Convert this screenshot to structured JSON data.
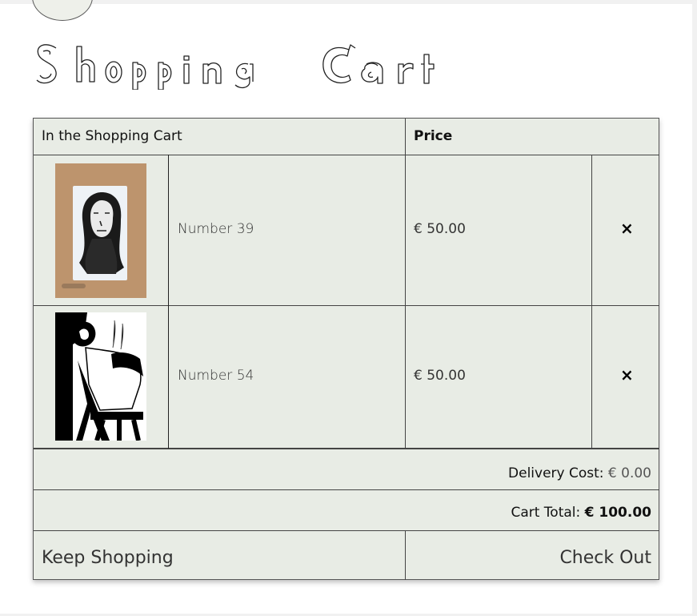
{
  "title": "Shopping Cart",
  "table": {
    "header_item": "In the Shopping Cart",
    "header_price": "Price"
  },
  "items": [
    {
      "name": "Number 39",
      "price": "€ 50.00",
      "remove_icon": "×"
    },
    {
      "name": "Number 54",
      "price": "€ 50.00",
      "remove_icon": "×"
    }
  ],
  "summary": {
    "delivery_label": "Delivery Cost:",
    "delivery_value": "€ 0.00",
    "total_label": "Cart Total:",
    "total_value": "€ 100.00"
  },
  "actions": {
    "keep_shopping": "Keep Shopping",
    "check_out": "Check Out"
  }
}
